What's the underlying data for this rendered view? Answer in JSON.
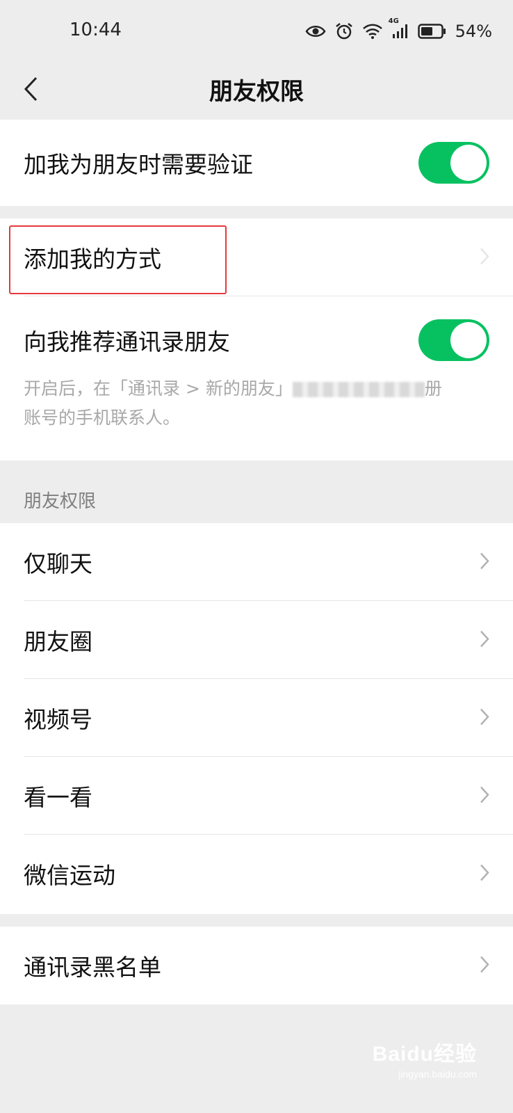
{
  "status_bar": {
    "time": "10:44",
    "network": "4G",
    "battery_percent": "54%",
    "icons": [
      "eye-icon",
      "alarm-icon",
      "wifi-icon",
      "signal-icon",
      "battery-icon"
    ]
  },
  "nav": {
    "title": "朋友权限",
    "back_icon": "chevron-left-icon"
  },
  "settings": {
    "verify": {
      "label": "加我为朋友时需要验证",
      "enabled": true
    },
    "add_methods": {
      "label": "添加我的方式"
    },
    "recommend": {
      "label": "向我推荐通讯录朋友",
      "enabled": true,
      "desc_prefix": "开启后，在「通讯录 > 新的朋友」",
      "desc_suffix": "册",
      "desc_line2": "账号的手机联系人。"
    }
  },
  "permissions": {
    "section_label": "朋友权限",
    "items": [
      {
        "label": "仅聊天"
      },
      {
        "label": "朋友圈"
      },
      {
        "label": "视频号"
      },
      {
        "label": "看一看"
      },
      {
        "label": "微信运动"
      }
    ]
  },
  "blacklist": {
    "label": "通讯录黑名单"
  },
  "watermark": {
    "main": "Baidu经验",
    "sub": "jingyan.baidu.com"
  },
  "colors": {
    "toggle_on": "#07c160",
    "background": "#ededed",
    "highlight": "#e5393b"
  }
}
